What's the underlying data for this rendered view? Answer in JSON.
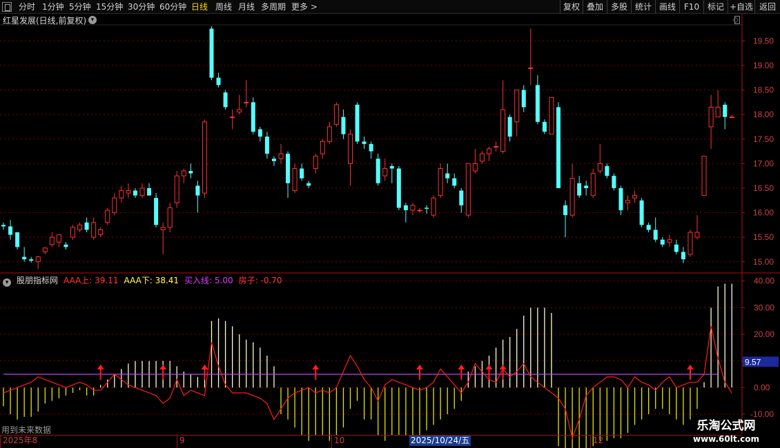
{
  "toolbar": {
    "periods": [
      "分时",
      "1分钟",
      "5分钟",
      "15分钟",
      "30分钟",
      "60分钟",
      "日线",
      "周线",
      "月线",
      "多周期",
      "更多 >"
    ],
    "active_period": "日线",
    "right_buttons": [
      "复权",
      "叠加",
      "多股",
      "统计",
      "画线",
      "F10",
      "标记",
      "+自选",
      "返回"
    ]
  },
  "main_chart": {
    "title": "红星发展(日线,前复权)",
    "price_ticks": [
      "19.50",
      "19.00",
      "18.50",
      "18.00",
      "17.50",
      "17.00",
      "16.50",
      "16.00",
      "15.50",
      "15.00"
    ]
  },
  "indicator": {
    "name": "股朋指标网",
    "aaa_up": "AAA上: 39.11",
    "aaa_down": "AAA下: 38.41",
    "buy_line": "买入线: 5.00",
    "house": "房子: -0.70",
    "ticks": [
      "40.00",
      "30.00",
      "20.00",
      "10.00",
      "0.00",
      "-10.00"
    ],
    "current_value": "9.57"
  },
  "footer": {
    "future_note": "用到未来数据",
    "dates": [
      "2025年8",
      "9",
      "10",
      "12"
    ],
    "cursor_date": "2025/10/24/五"
  },
  "watermark": {
    "title": "乐淘公式网",
    "url": "www.60lt.com"
  },
  "colors": {
    "up": "#ff3232",
    "down": "#54ffff",
    "pos_bar": "#ffffd0",
    "neg_bar": "#e6e600",
    "line": "#ff1e1e",
    "buy_line": "#c040ff",
    "grid": "#8b0000",
    "arrow": "#ff2020"
  },
  "chart_data": [
    {
      "type": "candlestick",
      "title": "红星发展(日线,前复权)",
      "ylim": [
        14.8,
        19.8
      ],
      "x_labels": [
        "2025年8",
        "9",
        "10",
        "12"
      ],
      "series": [
        {
          "ohlc": [
            [
              15.75,
              15.8,
              15.65,
              15.72
            ],
            [
              15.72,
              15.85,
              15.45,
              15.55
            ],
            [
              15.6,
              15.6,
              15.25,
              15.3
            ],
            [
              15.1,
              15.3,
              15.0,
              15.05
            ],
            [
              15.05,
              15.1,
              14.98,
              15.02
            ],
            [
              15.0,
              15.12,
              14.85,
              15.1
            ],
            [
              15.2,
              15.3,
              15.15,
              15.28
            ],
            [
              15.35,
              15.6,
              15.3,
              15.5
            ],
            [
              15.4,
              15.55,
              15.3,
              15.55
            ],
            [
              15.35,
              15.4,
              15.25,
              15.3
            ],
            [
              15.5,
              15.75,
              15.45,
              15.7
            ],
            [
              15.65,
              15.8,
              15.6,
              15.75
            ],
            [
              15.8,
              15.9,
              15.6,
              15.65
            ],
            [
              15.5,
              15.9,
              15.45,
              15.8
            ],
            [
              15.55,
              15.7,
              15.5,
              15.65
            ],
            [
              15.8,
              16.1,
              15.75,
              16.05
            ],
            [
              16.0,
              16.4,
              15.95,
              16.3
            ],
            [
              16.3,
              16.55,
              16.2,
              16.45
            ],
            [
              16.4,
              16.6,
              16.3,
              16.45
            ],
            [
              16.45,
              16.5,
              16.3,
              16.35
            ],
            [
              16.35,
              16.6,
              16.3,
              16.5
            ],
            [
              16.5,
              16.6,
              16.35,
              16.35
            ],
            [
              16.3,
              16.4,
              15.7,
              15.75
            ],
            [
              15.65,
              15.8,
              15.15,
              15.7
            ],
            [
              15.7,
              16.2,
              15.6,
              16.1
            ],
            [
              16.2,
              16.85,
              16.1,
              16.75
            ],
            [
              16.75,
              16.9,
              16.6,
              16.85
            ],
            [
              16.85,
              17.0,
              16.7,
              16.8
            ],
            [
              16.55,
              16.65,
              16.0,
              16.35
            ],
            [
              16.4,
              17.9,
              16.3,
              17.85
            ],
            [
              19.75,
              19.8,
              18.7,
              18.75
            ],
            [
              18.75,
              18.85,
              18.55,
              18.6
            ],
            [
              18.45,
              18.5,
              18.1,
              18.15
            ],
            [
              17.95,
              18.1,
              17.7,
              17.95
            ],
            [
              18.05,
              18.4,
              18.0,
              18.1
            ],
            [
              18.25,
              18.7,
              18.15,
              18.25
            ],
            [
              18.25,
              18.35,
              17.6,
              17.65
            ],
            [
              17.7,
              17.75,
              17.45,
              17.55
            ],
            [
              17.55,
              17.65,
              17.1,
              17.2
            ],
            [
              17.1,
              17.15,
              16.95,
              17.05
            ],
            [
              17.1,
              17.4,
              17.0,
              17.2
            ],
            [
              17.2,
              17.25,
              16.3,
              16.6
            ],
            [
              16.45,
              17.0,
              16.4,
              16.9
            ],
            [
              16.9,
              17.0,
              16.65,
              16.7
            ],
            [
              16.6,
              16.65,
              16.5,
              16.55
            ],
            [
              16.9,
              17.2,
              16.8,
              17.15
            ],
            [
              17.2,
              17.5,
              17.1,
              17.45
            ],
            [
              17.45,
              17.85,
              17.4,
              17.75
            ],
            [
              17.8,
              18.25,
              17.75,
              18.2
            ],
            [
              17.95,
              18.1,
              17.5,
              17.6
            ],
            [
              17.0,
              17.7,
              16.55,
              17.6
            ],
            [
              18.2,
              18.25,
              17.4,
              17.45
            ],
            [
              17.45,
              17.55,
              17.3,
              17.4
            ],
            [
              17.4,
              17.45,
              17.1,
              17.25
            ],
            [
              17.1,
              17.2,
              16.55,
              16.6
            ],
            [
              16.75,
              17.1,
              16.65,
              16.9
            ],
            [
              16.95,
              17.0,
              16.6,
              16.9
            ],
            [
              16.9,
              16.95,
              16.05,
              16.1
            ],
            [
              16.15,
              16.2,
              15.8,
              16.05
            ],
            [
              16.05,
              16.2,
              15.95,
              16.15
            ],
            [
              16.05,
              16.1,
              16.0,
              16.05
            ],
            [
              16.1,
              16.15,
              15.98,
              16.08
            ],
            [
              15.95,
              16.35,
              15.9,
              16.3
            ],
            [
              16.35,
              17.0,
              16.3,
              16.9
            ],
            [
              16.8,
              17.0,
              16.6,
              16.7
            ],
            [
              16.7,
              16.8,
              16.5,
              16.55
            ],
            [
              16.45,
              16.5,
              16.0,
              16.15
            ],
            [
              15.95,
              17.0,
              15.9,
              17.0
            ],
            [
              16.85,
              17.3,
              16.8,
              17.0
            ],
            [
              17.05,
              17.25,
              17.0,
              17.2
            ],
            [
              17.2,
              17.35,
              17.05,
              17.3
            ],
            [
              17.35,
              17.45,
              17.25,
              17.35
            ],
            [
              17.25,
              18.7,
              17.2,
              18.1
            ],
            [
              17.95,
              18.0,
              17.45,
              17.55
            ],
            [
              17.85,
              18.5,
              17.55,
              18.5
            ],
            [
              18.5,
              18.6,
              18.05,
              18.15
            ],
            [
              18.95,
              19.75,
              18.6,
              18.95
            ],
            [
              18.6,
              18.8,
              17.8,
              17.85
            ],
            [
              17.85,
              17.9,
              17.6,
              17.65
            ],
            [
              17.6,
              18.0,
              17.6,
              18.35
            ],
            [
              18.15,
              18.25,
              16.5,
              16.5
            ],
            [
              16.15,
              16.25,
              15.5,
              15.95
            ],
            [
              15.95,
              17.0,
              15.9,
              16.7
            ],
            [
              16.6,
              16.75,
              16.3,
              16.35
            ],
            [
              16.55,
              16.65,
              16.35,
              16.5
            ],
            [
              16.35,
              16.9,
              16.3,
              16.8
            ],
            [
              16.85,
              17.4,
              16.8,
              17.0
            ],
            [
              16.95,
              17.0,
              16.7,
              16.75
            ],
            [
              16.75,
              16.8,
              16.45,
              16.5
            ],
            [
              16.5,
              16.55,
              15.95,
              16.05
            ],
            [
              16.2,
              16.35,
              16.05,
              16.25
            ],
            [
              16.3,
              16.45,
              16.2,
              16.35
            ],
            [
              16.25,
              16.3,
              15.7,
              15.75
            ],
            [
              15.75,
              15.8,
              15.6,
              15.65
            ],
            [
              15.65,
              15.9,
              15.4,
              15.45
            ],
            [
              15.45,
              15.5,
              15.3,
              15.35
            ],
            [
              15.4,
              15.55,
              15.3,
              15.45
            ],
            [
              15.35,
              15.45,
              15.15,
              15.2
            ],
            [
              15.2,
              15.3,
              14.97,
              15.05
            ],
            [
              15.15,
              15.65,
              15.1,
              15.6
            ],
            [
              15.5,
              15.95,
              15.45,
              15.6
            ],
            [
              16.35,
              17.15,
              16.35,
              17.15
            ],
            [
              17.75,
              18.4,
              17.3,
              18.15
            ],
            [
              17.95,
              18.5,
              17.95,
              18.15
            ],
            [
              18.2,
              18.25,
              17.7,
              17.95
            ],
            [
              17.95,
              18.0,
              17.95,
              17.95
            ]
          ]
        }
      ]
    },
    {
      "type": "bar",
      "title": "股朋指标网",
      "ylim": [
        -17,
        42
      ],
      "buy_line": 5.0,
      "series": [
        {
          "name": "AAA上",
          "values": [
            -7,
            -10,
            -12,
            -11,
            -11,
            -9,
            -6,
            -5,
            -4,
            -3,
            -2,
            -1,
            -3,
            -3,
            1,
            3,
            5,
            7,
            9,
            10,
            10,
            10,
            10,
            10,
            10,
            8,
            6,
            5,
            4,
            3,
            25,
            26,
            25,
            23,
            20,
            18,
            17,
            15,
            12,
            8,
            -10,
            -12,
            -15,
            -18,
            -20,
            -18,
            -18,
            -20,
            -18,
            -15,
            -8,
            -5,
            -12,
            -12,
            -18,
            -20,
            -18,
            -18,
            -18,
            -18,
            -18,
            -16,
            -14,
            -12,
            -10,
            -8,
            -5,
            6,
            8,
            10,
            12,
            15,
            18,
            19,
            22,
            27,
            30,
            30,
            30,
            28,
            -22,
            -24,
            -23,
            -24,
            -23,
            -22,
            -20,
            -20,
            -19,
            -19,
            -17,
            -14,
            -12,
            -10,
            -8,
            -8,
            -10,
            -12,
            -14,
            -12,
            -8,
            2,
            30,
            38,
            39,
            39
          ]
        },
        {
          "name": "房子",
          "values": [
            -2,
            -1,
            0,
            1,
            2,
            4,
            3,
            2,
            1,
            0,
            1,
            2,
            1,
            -1,
            -1,
            2,
            5,
            3,
            1,
            0,
            -1,
            -2,
            -3,
            -6,
            -4,
            3,
            -3,
            -1,
            -2,
            -3,
            17,
            8,
            1,
            -2,
            -2,
            -2,
            -3,
            -4,
            -6,
            -12,
            -8,
            -4,
            -2,
            -1,
            0,
            -2,
            -1,
            -2,
            0,
            6,
            12,
            8,
            3,
            0,
            -5,
            1,
            3,
            2,
            1,
            0,
            -1,
            0,
            2,
            7,
            4,
            1,
            -2,
            2,
            9,
            6,
            3,
            2,
            7,
            4,
            6,
            9,
            4,
            2,
            0,
            -2,
            -4,
            -8,
            -19,
            -12,
            -3,
            0,
            2,
            4,
            4,
            3,
            0,
            4,
            2,
            1,
            -1,
            2,
            4,
            0,
            1,
            2,
            2,
            5,
            23,
            11,
            2,
            -2
          ]
        }
      ],
      "buy_signals": [
        14,
        23,
        29,
        45,
        60,
        66,
        70,
        72,
        99
      ]
    }
  ]
}
